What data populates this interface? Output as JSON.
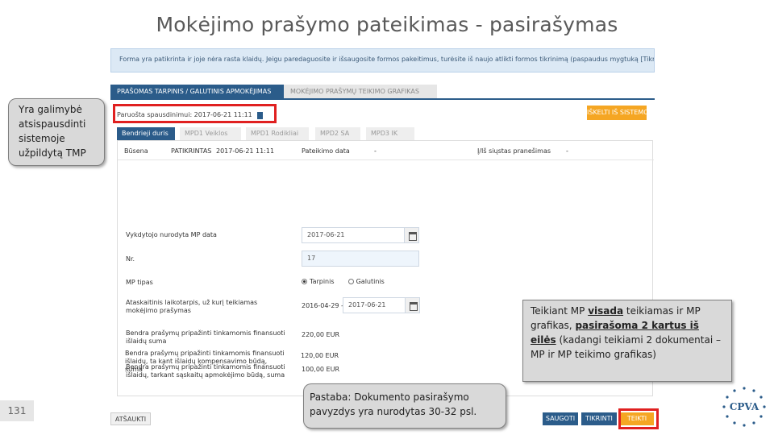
{
  "slide": {
    "title": "Mokėjimo prašymo pateikimas - pasirašymas",
    "number": "131"
  },
  "app": {
    "info_banner": "Forma yra patikrinta ir joje nėra rasta klaidų. Jeigu paredaguosite ir išsaugosite formos pakeitimus, turėsite iš naujo atlikti formos tikrinimą (paspaudus mygtuką [Tikrinti])",
    "main_tabs": [
      {
        "label": "PRAŠOMAS TARPINIS / GALUTINIS APMOKĖJIMAS",
        "active": true
      },
      {
        "label": "MOKĖJIMO PRAŠYMŲ TEIKIMO GRAFIKAS",
        "active": false
      }
    ],
    "print_label": "Paruošta spausdinimui: 2017-06-21 11:11",
    "send_to_system_label": "IŠKELTI IŠ SISTEMOS",
    "sub_tabs": [
      {
        "label": "Bendrieji duris",
        "active": true
      },
      {
        "label": "MPD1 Veiklos",
        "active": false
      },
      {
        "label": "MPD1 Rodikliai",
        "active": false
      },
      {
        "label": "MPD2 SA",
        "active": false
      },
      {
        "label": "MPD3 IK",
        "active": false
      }
    ],
    "status": {
      "label": "Būsena",
      "value": "PATIKRINTAS",
      "date": "2017-06-21 11:11",
      "submit_label": "Pateikimo data",
      "submit_value": "-",
      "sent_label": "Į/Iš siųstas pranešimas",
      "sent_value": "-"
    },
    "fields": {
      "executor_date_label": "Vykdytojo nurodyta MP data",
      "executor_date_value": "2017-06-21",
      "number_label": "Nr.",
      "number_value": "17",
      "type_label": "MP tipas",
      "type_option_interim": "Tarpinis",
      "type_option_final": "Galutinis",
      "period_label": "Ataskaitinis laikotarpis, už kurį teikiamas mokėjimo prašymas",
      "period_from": "2016-04-29 -",
      "period_to": "2017-06-21",
      "total_label": "Bendra prašymų pripažinti tinkamomis finansuoti išlaidų suma",
      "total_value": "220,00 EUR",
      "invoice_label": "Bendra prašymų pripažinti tinkamomis finansuoti išlaidų, tarkant sąskaitų apmokėjimo būdą, suma",
      "invoice_value": "100,00 EUR",
      "compensation_label": "Bendra prašymų pripažinti tinkamomis finansuoti išlaidų, ta kant išlaidų kompensavimo būdą, suma",
      "compensation_value": "120,00 EUR"
    },
    "buttons": {
      "cancel": "ATŠAUKTI",
      "save": "SAUGOTI",
      "check": "TIKRINTI",
      "send": "TEIKTI"
    }
  },
  "callouts": {
    "left": "Yra galimybė atsispausdinti sistemoje užpildytą TMP",
    "right_part1": "Teikiant MP ",
    "right_always": "visada",
    "right_part2": " teikiamas ir MP grafikas, ",
    "right_signed": "pasirašoma 2 kartus iš eilės",
    "right_part3": " (kadangi teikiami 2 dokumentai – MP ir MP teikimo grafikas)",
    "note": "Pastaba: Dokumento pasirašymo pavyzdys yra nurodytas 30-32 psl."
  },
  "logo": {
    "text": "CPVA"
  },
  "colors": {
    "primary": "#2b5c8a",
    "accent": "#f5a623",
    "highlight": "#e02020"
  }
}
